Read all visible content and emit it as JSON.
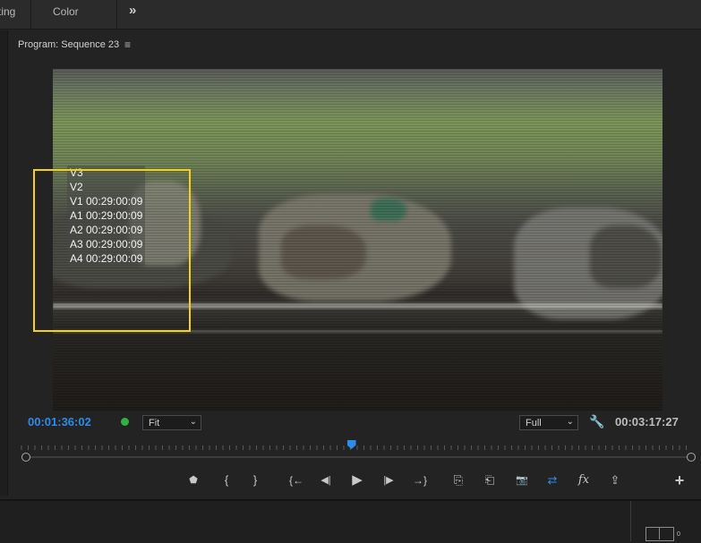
{
  "top_tabs": {
    "first": "ting",
    "second": "Color",
    "more": "»"
  },
  "program": {
    "title": "Program: Sequence 23",
    "menu_icon": "≡"
  },
  "overlay": {
    "lines": [
      "V3",
      "V2",
      "V1 00:29:00:09",
      "A1 00:29:00:09",
      "A2 00:29:00:09",
      "A3 00:29:00:09",
      "A4 00:29:00:09"
    ]
  },
  "playback": {
    "current_timecode": "00:01:36:02",
    "duration_timecode": "00:03:17:27",
    "zoom": "Fit",
    "resolution": "Full",
    "playhead_fraction": 0.49
  },
  "controls": {
    "marker": "⬟",
    "mark_in": "{",
    "mark_out": "}",
    "go_to_in": "{←",
    "step_back": "◀|",
    "play": "▶",
    "step_forward": "|▶",
    "go_to_out": "→}",
    "insert": "⎘",
    "overwrite": "⎗",
    "export_frame": "📷",
    "multicam": "⇄",
    "fx": "fx",
    "share": "⇪",
    "add": "+"
  },
  "meter": {
    "label": "0"
  },
  "colors": {
    "accent": "#2d8ceb",
    "highlight": "#f7d117",
    "status_dot": "#2fb240"
  }
}
